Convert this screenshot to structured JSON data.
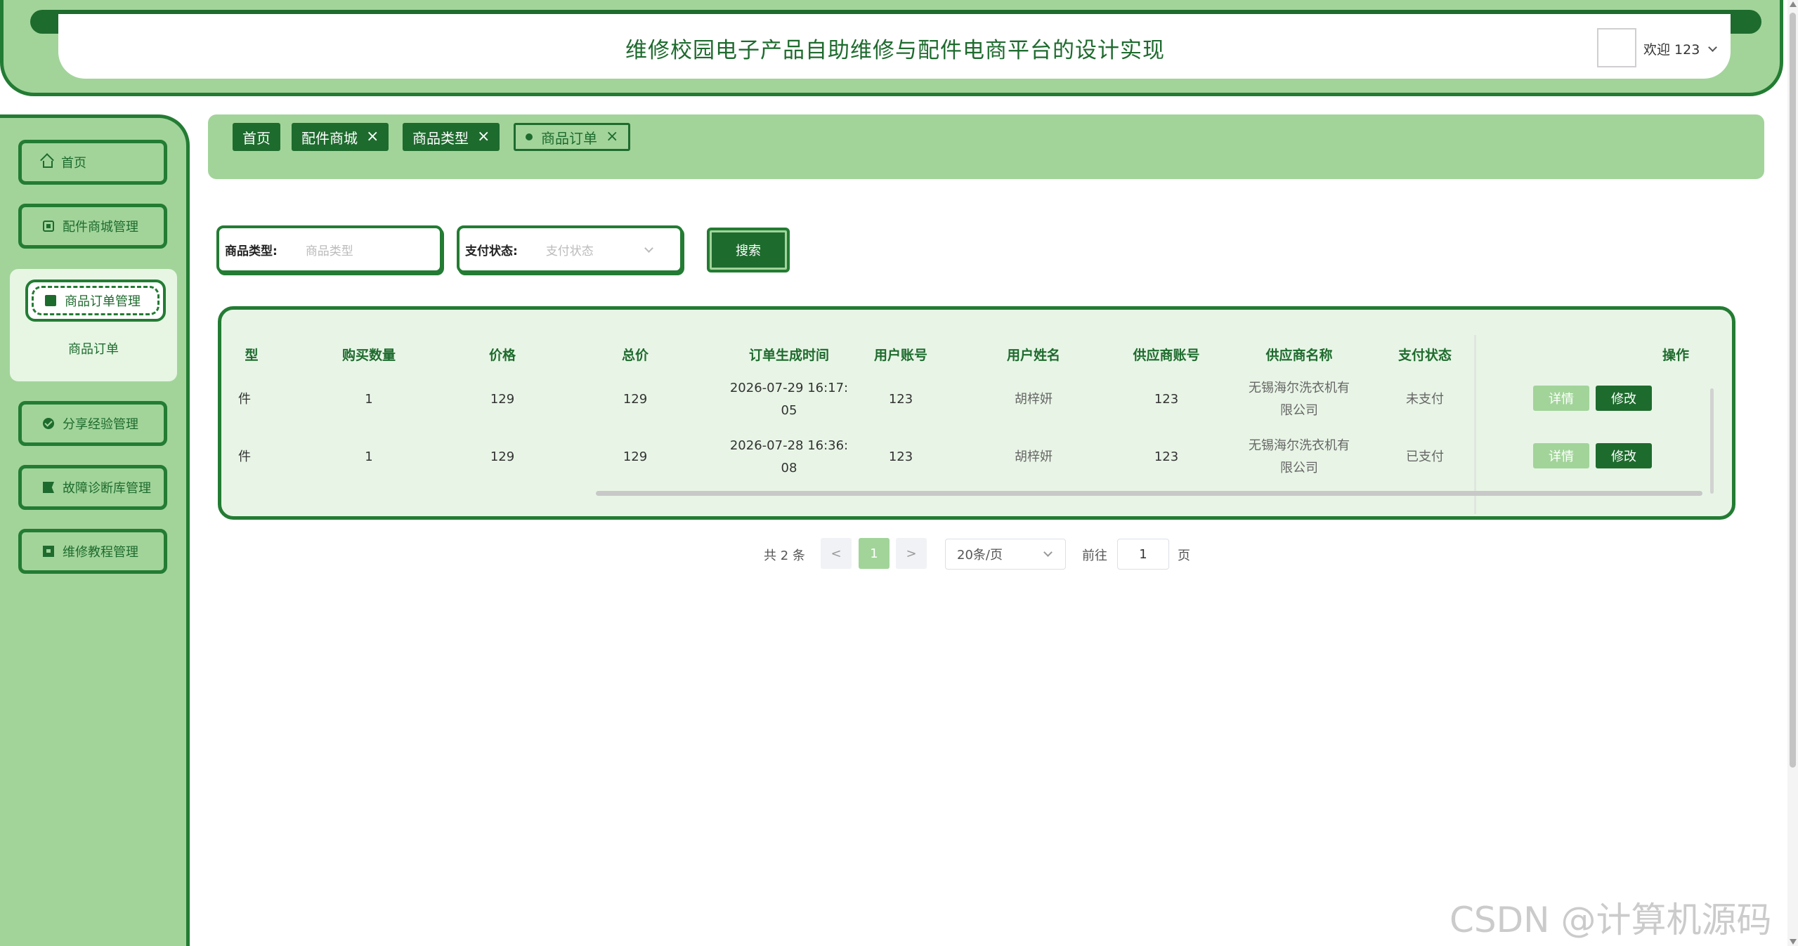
{
  "header": {
    "title": "维修校园电子产品自助维修与配件电商平台的设计实现",
    "welcome": "欢迎 123"
  },
  "sidebar": {
    "items": [
      {
        "label": "首页",
        "icon": "home-icon"
      },
      {
        "label": "配件商城管理",
        "icon": "chip-icon"
      },
      {
        "label": "商品订单管理",
        "icon": "book-icon"
      },
      {
        "label": "分享经验管理",
        "icon": "check-circle-icon"
      },
      {
        "label": "故障诊断库管理",
        "icon": "flag-icon"
      },
      {
        "label": "维修教程管理",
        "icon": "doc-icon"
      }
    ],
    "submenu": "商品订单"
  },
  "tabs": [
    {
      "label": "首页"
    },
    {
      "label": "配件商城"
    },
    {
      "label": "商品类型"
    },
    {
      "label": "商品订单"
    }
  ],
  "search": {
    "type_label": "商品类型:",
    "type_placeholder": "商品类型",
    "pay_label": "支付状态:",
    "pay_placeholder": "支付状态",
    "button": "搜索"
  },
  "table": {
    "headers": [
      "型",
      "购买数量",
      "价格",
      "总价",
      "订单生成时间",
      "用户账号",
      "用户姓名",
      "供应商账号",
      "供应商名称",
      "支付状态",
      "操作"
    ],
    "rows": [
      {
        "type": "件",
        "qty": "1",
        "price": "129",
        "total": "129",
        "time_a": "2026-07-29 16:17:",
        "time_b": "05",
        "account": "123",
        "name": "胡梓妍",
        "supplier_account": "123",
        "supplier_a": "无锡海尔洗衣机有",
        "supplier_b": "限公司",
        "status": "未支付"
      },
      {
        "type": "件",
        "qty": "1",
        "price": "129",
        "total": "129",
        "time_a": "2026-07-28 16:36:",
        "time_b": "08",
        "account": "123",
        "name": "胡梓妍",
        "supplier_account": "123",
        "supplier_a": "无锡海尔洗衣机有",
        "supplier_b": "限公司",
        "status": "已支付"
      }
    ],
    "detail_label": "详情",
    "edit_label": "修改"
  },
  "pagination": {
    "total": "共 2 条",
    "prev": "<",
    "current": "1",
    "next": ">",
    "page_size": "20条/页",
    "goto": "前往",
    "goto_value": "1",
    "page_unit": "页"
  },
  "watermark": "CSDN @计算机源码站",
  "colors": {
    "dark_green": "#1e6b2e",
    "light_green": "#a2d49a",
    "pale_green": "#e8f5e6"
  }
}
